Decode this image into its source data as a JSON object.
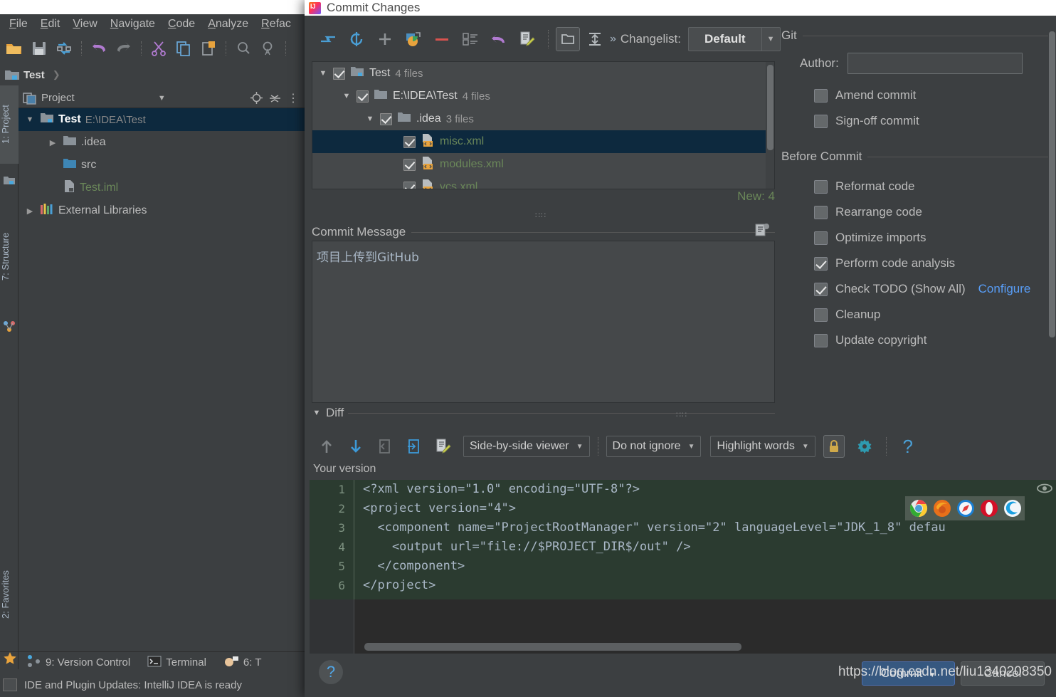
{
  "ide": {
    "menu": [
      "File",
      "Edit",
      "View",
      "Navigate",
      "Code",
      "Analyze",
      "Refac"
    ],
    "breadcrumb": "Test",
    "project_panel": {
      "title": "Project",
      "tree": [
        {
          "label": "Test",
          "sub": "E:\\IDEA\\Test",
          "tri": "▼",
          "icon": "module-folder-icon",
          "selected": true,
          "indent": 0,
          "green": false
        },
        {
          "label": ".idea",
          "sub": "",
          "tri": "▶",
          "icon": "folder-icon",
          "selected": false,
          "indent": 1,
          "green": false
        },
        {
          "label": "src",
          "sub": "",
          "tri": "",
          "icon": "source-folder-icon",
          "selected": false,
          "indent": 1,
          "green": false
        },
        {
          "label": "Test.iml",
          "sub": "",
          "tri": "",
          "icon": "iml-file-icon",
          "selected": false,
          "indent": 1,
          "green": true
        },
        {
          "label": "External Libraries",
          "sub": "",
          "tri": "▶",
          "icon": "libraries-icon",
          "selected": false,
          "indent": 0,
          "green": false
        }
      ]
    },
    "rail_tabs": [
      {
        "label": "1: Project",
        "active": true
      },
      {
        "label": "7: Structure",
        "active": false
      },
      {
        "label": "2: Favorites",
        "active": false
      }
    ],
    "status_items": [
      "9: Version Control",
      "Terminal",
      "6: T"
    ],
    "status_message": "IDE and Plugin Updates: IntelliJ IDEA is ready"
  },
  "dialog": {
    "title": "Commit Changes",
    "changelist_label": "Changelist:",
    "changelist_value": "Default",
    "toolbar_icons": [
      "show-diff-icon",
      "refresh-icon",
      "add-icon",
      "move-to-changelist-icon",
      "delete-icon",
      "checkbox-list-icon",
      "revert-icon",
      "edit-source-icon",
      "group-by-directory-icon",
      "expand-collapse-icon"
    ],
    "file_tree": [
      {
        "tri": "▼",
        "label": "Test",
        "count": "4 files",
        "indent": 0,
        "icon": "module-folder-icon",
        "checked": true,
        "selected": false,
        "file": false
      },
      {
        "tri": "▼",
        "label": "E:\\IDEA\\Test",
        "count": "4 files",
        "indent": 1,
        "icon": "folder-icon",
        "checked": true,
        "selected": false,
        "file": false
      },
      {
        "tri": "▼",
        "label": ".idea",
        "count": "3 files",
        "indent": 2,
        "icon": "folder-icon",
        "checked": true,
        "selected": false,
        "file": false
      },
      {
        "tri": "",
        "label": "misc.xml",
        "count": "",
        "indent": 3,
        "icon": "xml-file-icon",
        "checked": true,
        "selected": true,
        "file": true
      },
      {
        "tri": "",
        "label": "modules.xml",
        "count": "",
        "indent": 3,
        "icon": "xml-file-icon",
        "checked": true,
        "selected": false,
        "file": true
      },
      {
        "tri": "",
        "label": "vcs.xml",
        "count": "",
        "indent": 3,
        "icon": "xml-file-icon",
        "checked": true,
        "selected": false,
        "file": true
      }
    ],
    "new_count": "New: 4",
    "commit_message_label": "Commit Message",
    "commit_message_value": "项目上传到GitHub",
    "diff_label": "Diff",
    "diff_toolbar": {
      "icons": [
        "prev-difference-icon",
        "next-difference-icon",
        "revert-icon",
        "apply-icon",
        "edit-source-icon"
      ],
      "viewer_mode": "Side-by-side viewer",
      "ignore_mode": "Do not ignore",
      "highlight_mode": "Highlight words",
      "lock_icon": "read-only-lock-icon",
      "settings_icon": "gear-icon",
      "help_icon": "help-icon"
    },
    "your_version_label": "Your version",
    "code": {
      "line_numbers": [
        "1",
        "2",
        "3",
        "4",
        "5",
        "6"
      ],
      "lines": [
        "<?xml version=\"1.0\" encoding=\"UTF-8\"?>",
        "<project version=\"4\">",
        "  <component name=\"ProjectRootManager\" version=\"2\" languageLevel=\"JDK_1_8\" defau",
        "    <output url=\"file://$PROJECT_DIR$/out\" />",
        "  </component>",
        "</project>"
      ]
    },
    "browser_icons": [
      "chrome-icon",
      "firefox-icon",
      "safari-icon",
      "opera-icon",
      "edge-icon"
    ],
    "footer": {
      "help_label": "?",
      "commit_label": "Commit",
      "cancel_label": "Cancel",
      "watermark": "https://blog.csdn.net/liu1340208350"
    }
  },
  "options": {
    "git_section": "Git",
    "author_label": "Author:",
    "author_value": "",
    "git_checks": [
      {
        "label": "Amend commit",
        "checked": false
      },
      {
        "label": "Sign-off commit",
        "checked": false
      }
    ],
    "before_commit_section": "Before Commit",
    "before_checks": [
      {
        "label": "Reformat code",
        "checked": false,
        "link": ""
      },
      {
        "label": "Rearrange code",
        "checked": false,
        "link": ""
      },
      {
        "label": "Optimize imports",
        "checked": false,
        "link": ""
      },
      {
        "label": "Perform code analysis",
        "checked": true,
        "link": ""
      },
      {
        "label": "Check TODO (Show All)",
        "checked": true,
        "link": "Configure"
      },
      {
        "label": "Cleanup",
        "checked": false,
        "link": ""
      },
      {
        "label": "Update copyright",
        "checked": false,
        "link": ""
      }
    ]
  },
  "colors": {
    "accent_blue": "#589df6",
    "selection": "#0d293e",
    "green_text": "#6a8759",
    "panel_bg": "#3c3f41",
    "commit_button": "#365880"
  }
}
